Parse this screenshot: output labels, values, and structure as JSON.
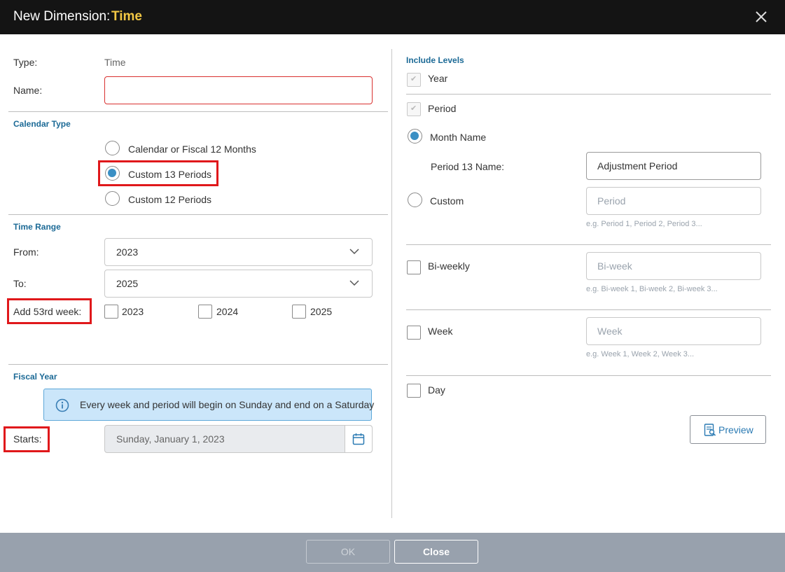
{
  "title": {
    "prefix": "New Dimension:",
    "name": "Time"
  },
  "left": {
    "type_label": "Type:",
    "type_value": "Time",
    "name_label": "Name:",
    "name_value": "",
    "calendar_section": "Calendar Type",
    "calendar_options": [
      "Calendar or Fiscal 12 Months",
      "Custom 13 Periods",
      "Custom 12 Periods"
    ],
    "calendar_selected": "Custom 13 Periods",
    "time_range_section": "Time Range",
    "from_label": "From:",
    "from_value": "2023",
    "to_label": "To:",
    "to_value": "2025",
    "week53_label": "Add 53rd week:",
    "week53_years": [
      "2023",
      "2024",
      "2025"
    ],
    "fiscal_section": "Fiscal Year",
    "info_text": "Every week and period will begin on Sunday and end on a Saturday",
    "starts_label": "Starts:",
    "starts_value": "Sunday, January 1, 2023"
  },
  "right": {
    "include_section": "Include Levels",
    "year_label": "Year",
    "period_label": "Period",
    "month_name_label": "Month Name",
    "period13_label": "Period 13 Name:",
    "period13_value": "Adjustment Period",
    "custom_label": "Custom",
    "custom_placeholder": "Period",
    "custom_hint": "e.g. Period 1, Period 2, Period 3...",
    "biweekly_label": "Bi-weekly",
    "biweekly_placeholder": "Bi-week",
    "biweekly_hint": "e.g. Bi-week 1, Bi-week 2, Bi-week 3...",
    "week_label": "Week",
    "week_placeholder": "Week",
    "week_hint": "e.g. Week 1, Week 2, Week 3...",
    "day_label": "Day",
    "preview_label": "Preview"
  },
  "footer": {
    "ok_label": "OK",
    "close_label": "Close"
  },
  "colors": {
    "accent": "#3a8fc4",
    "title_accent": "#f2c744",
    "error": "#d9302f",
    "highlight": "#e0181b"
  },
  "icons": [
    "close-icon",
    "chevron-down-icon",
    "info-icon",
    "calendar-icon",
    "preview-icon",
    "checkmark-icon"
  ]
}
